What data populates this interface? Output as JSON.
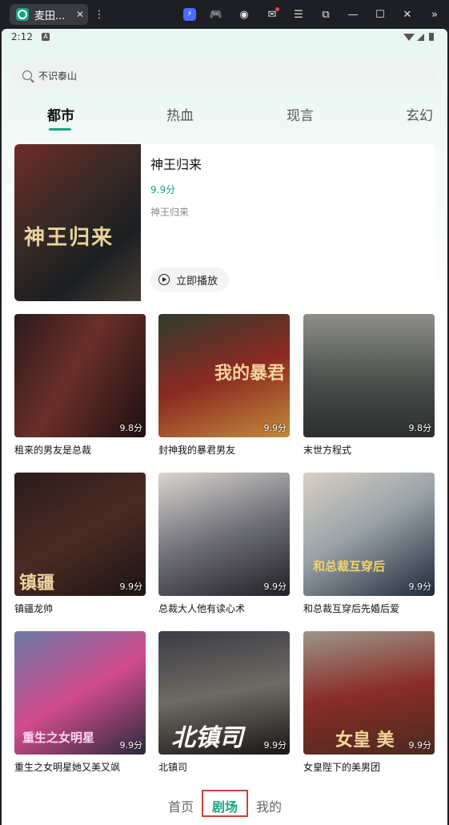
{
  "window": {
    "tab_title": "麦田...",
    "close_glyph": "✕",
    "icons": [
      "more-vert-icon",
      "bolt-icon",
      "gamepad-icon",
      "account-icon",
      "mail-icon",
      "menu-icon",
      "screenshot-icon",
      "minimize-icon",
      "maximize-icon",
      "close-icon",
      "expand-icon"
    ]
  },
  "status": {
    "time": "2:12",
    "app_badge": "A"
  },
  "search": {
    "placeholder_text": "不识泰山"
  },
  "categories": [
    "都市",
    "热血",
    "现言",
    "玄幻"
  ],
  "featured": {
    "title": "神王归来",
    "score": "9.9分",
    "description": "神王归来",
    "play_label": "立即播放",
    "poster_text": "神王归来"
  },
  "cards": [
    {
      "title": "租来的男友是总裁",
      "score": "9.8分"
    },
    {
      "title": "封神我的暴君男友",
      "score": "9.9分",
      "poster_text": "我的暴君"
    },
    {
      "title": "末世方程式",
      "score": "9.8分"
    },
    {
      "title": "镇疆龙帅",
      "score": "9.9分",
      "poster_text": "镇疆"
    },
    {
      "title": "总裁大人他有读心术",
      "score": "9.9分"
    },
    {
      "title": "和总裁互穿后先婚后爱",
      "score": "9.9分",
      "poster_text": "和总裁互穿后"
    },
    {
      "title": "重生之女明星她又美又飒",
      "score": "9.9分",
      "poster_text": "重生之女明星"
    },
    {
      "title": "北镇司",
      "score": "9.9分",
      "poster_text": "北镇司"
    },
    {
      "title": "女皇陛下的美男团",
      "score": "9.9分",
      "poster_text": "女皇 美"
    }
  ],
  "nav": {
    "home": "首页",
    "theater": "剧场",
    "mine": "我的"
  },
  "colors": {
    "accent": "#19a584",
    "highlight": "#d43f3f"
  }
}
